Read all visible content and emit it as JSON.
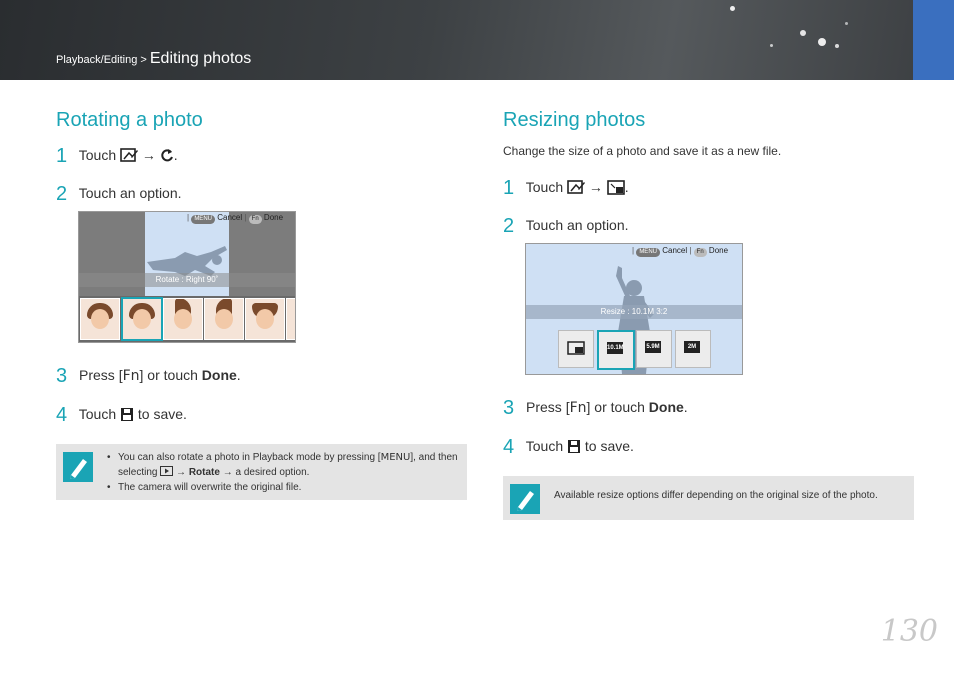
{
  "header": {
    "breadcrumb_parent": "Playback/Editing >",
    "breadcrumb_current": "Editing photos"
  },
  "rotate": {
    "title": "Rotating a photo",
    "step1": {
      "num": "1",
      "prefix": "Touch",
      "arrow": "→",
      "suffix": "."
    },
    "step2": {
      "num": "2",
      "text": "Touch an option."
    },
    "screen": {
      "menu_label": "MENU",
      "cancel": "Cancel",
      "fn_label": "Fn",
      "done": "Done",
      "bar_text": "Rotate : Right 90˚"
    },
    "step3": {
      "num": "3",
      "prefix": "Press [",
      "fn": "Fn",
      "middle": "] or touch",
      "bold": "Done",
      "suffix": "."
    },
    "step4": {
      "num": "4",
      "prefix": "Touch",
      "suffix": "to save."
    },
    "note": {
      "line1_a": "You can also rotate a photo in Playback mode by pressing [",
      "line1_menu": "MENU",
      "line1_b": "], and then",
      "line1_c": "selecting",
      "line1_arrow": "→",
      "line1_bold": "Rotate",
      "line1_d": "→ a desired option.",
      "line2": "The camera will overwrite the original file."
    }
  },
  "resize": {
    "title": "Resizing photos",
    "intro": "Change the size of a photo and save it as a new file.",
    "step1": {
      "num": "1",
      "prefix": "Touch",
      "arrow": "→",
      "suffix": "."
    },
    "step2": {
      "num": "2",
      "text": "Touch an option."
    },
    "screen": {
      "menu_label": "MENU",
      "cancel": "Cancel",
      "fn_label": "Fn",
      "done": "Done",
      "bar_text": "Resize : 10.1M 3:2",
      "options": [
        "",
        "10.1M",
        "5.9M",
        "2M"
      ]
    },
    "step3": {
      "num": "3",
      "prefix": "Press [",
      "fn": "Fn",
      "middle": "] or touch",
      "bold": "Done",
      "suffix": "."
    },
    "step4": {
      "num": "4",
      "prefix": "Touch",
      "suffix": "to save."
    },
    "note": {
      "text": "Available resize options differ depending on the original size of the photo."
    }
  },
  "page_number": "130",
  "colors": {
    "accent": "#1aa4b5",
    "tab": "#3a6fbf",
    "note_bg": "#e4e4e4"
  }
}
